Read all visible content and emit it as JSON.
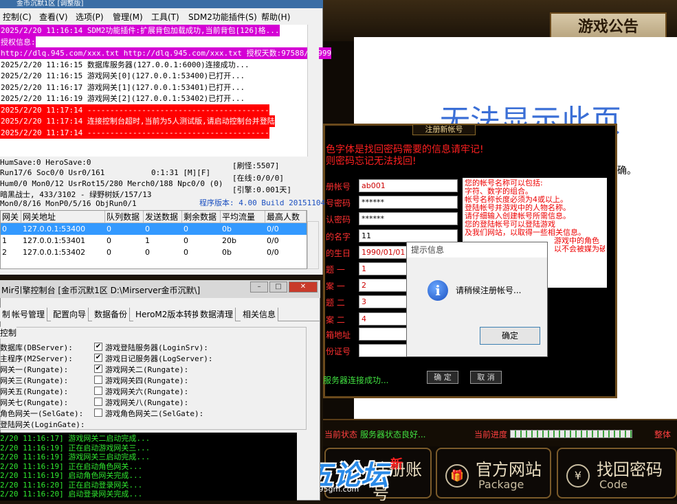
{
  "launcher": {
    "notice_title": "游戏公告",
    "notice_error": "无法显示此页",
    "notice_error_tail": "确。",
    "status_label": "当前状态",
    "status_value": "服务器状态良好...",
    "progress_label": "当前进度",
    "progress_fraction": 1.0,
    "overall_label": "整体",
    "buttons": [
      {
        "cn": "注册账号",
        "en": "",
        "icon": "user-icon"
      },
      {
        "cn": "官方网站",
        "en": "Package",
        "icon": "gift-icon"
      },
      {
        "cn": "找回密码",
        "en": "Code",
        "icon": "yen-icon"
      }
    ],
    "logo_text": "九五论坛",
    "logo_badge": "新",
    "logo_url": "www.95gm.com"
  },
  "register": {
    "title": "注册新帐号",
    "warn1": "色字体是找回密码需要的信息请牢记!",
    "warn2": "则密码忘记无法找回!",
    "fields": [
      {
        "label": "册帐号",
        "value": "ab001"
      },
      {
        "label": "号密码",
        "value": "******"
      },
      {
        "label": "认密码",
        "value": "******"
      },
      {
        "label": "的名字",
        "value": "11"
      },
      {
        "label": "的生日",
        "value": "1990/01/01"
      },
      {
        "label": "题 一",
        "value": "1"
      },
      {
        "label": "案 一",
        "value": "2"
      },
      {
        "label": "题 二",
        "value": "3"
      },
      {
        "label": "案 二",
        "value": "4"
      },
      {
        "label": "箱地址",
        "value": ""
      },
      {
        "label": "份证号",
        "value": ""
      }
    ],
    "hints": [
      "您的帐号名称可以包括:",
      "字符、数字的组合。",
      "帐号名称长度必须为4或以上。",
      "登陆帐号并游戏中的人物名称。",
      "请仔细输入创建帐号所需信息。",
      "您的登陆帐号可以登陆游戏",
      "及我们网站，以取得一些相关信息。",
      "",
      "游戏中的角色",
      "以不会被媒为破"
    ],
    "conn_text": "服务器连接成功...",
    "ok_label": "确 定",
    "cancel_label": "取 消"
  },
  "msgbox": {
    "title": "提示信息",
    "text": "请稍候注册帐号...",
    "ok_label": "确定"
  },
  "m2": {
    "title": "金币沉默1区 [调整版]",
    "menu": [
      "控制(C)",
      "查看(V)",
      "选项(P)",
      "管理(M)",
      "工具(T)",
      "SDM2功能插件(S)",
      "帮助(H)"
    ],
    "log": [
      {
        "text": "2025/2/20 11:16:14 SDM2功能插件:扩展背包加载成功,当前背包[126]格...",
        "style": "purple"
      },
      {
        "text": "授权信息:",
        "style": "purple"
      },
      {
        "text": "http://dlq.945.com/xxx.txt http://dlq.945.com/xxx.txt 授权天数:97588/99999",
        "style": "purple"
      },
      {
        "text": "2025/2/20 11:16:15 数据库服务器(127.0.0.1:6000)连接成功...",
        "style": "plain"
      },
      {
        "text": "2025/2/20 11:16:15 游戏网关[0](127.0.0.1:53400)已打开...",
        "style": "plain"
      },
      {
        "text": "2025/2/20 11:16:17 游戏网关[1](127.0.0.1:53401)已打开...",
        "style": "plain"
      },
      {
        "text": "2025/2/20 11:16:19 游戏网关[2](127.0.0.1:53402)已打开...",
        "style": "plain"
      },
      {
        "text": "2025/2/20 11:17:14 ----------------------------------------",
        "style": "red"
      },
      {
        "text": "2025/2/20 11:17:14 连接控制台超时,当前为5人测试版,请启动控制台并登陆",
        "style": "red"
      },
      {
        "text": "2025/2/20 11:17:14 ----------------------------------------",
        "style": "red"
      }
    ],
    "stats": {
      "line1": "HumSave:0 HeroSave:0",
      "line2": "Run17/6 Soc0/0 Usr0/161",
      "time": "0:1:31 [M][F]",
      "line3": "Hum0/0 Mon0/12 UsrRot15/280 Merch0/188 Npc0/0 (0)",
      "line4": "暗黑战士, 433/3102 - 绿野树妖/157/13",
      "line5": "Mon0/8/16 MonP0/5/16 ObjRun0/1",
      "refresh": "[刷怪:5507]",
      "online": "[在线:0/0/0]",
      "engine": "[引擎:0.001天]",
      "version": "程序版本: 4.00 Build 20151104"
    },
    "gateway_headers": [
      "网关",
      "网关地址",
      "队列数据",
      "发送数据",
      "剩余数据",
      "平均流量",
      "最高人数"
    ],
    "gateways": [
      [
        "0",
        "127.0.0.1:53400",
        "0",
        "0",
        "0",
        "0b",
        "0/0"
      ],
      [
        "1",
        "127.0.0.1:53401",
        "0",
        "1",
        "0",
        "20b",
        "0/0"
      ],
      [
        "2",
        "127.0.0.1:53402",
        "0",
        "0",
        "0",
        "0b",
        "0/0"
      ]
    ]
  },
  "cc": {
    "title": "Mir引擎控制台 [金币沉默1区 D:\\Mirserver金币沉默\\]",
    "tabs": [
      "制",
      "帐号管理",
      "配置向导",
      "数据备份",
      "HeroM2版本转换",
      "数据清理",
      "相关信息"
    ],
    "group_title": "控制",
    "left_items": [
      "数据库(DBServer):",
      "主程序(M2Server):",
      "网关一(Rungate):",
      "网关三(Rungate):",
      "网关五(Rungate):",
      "网关七(Rungate):",
      "角色网关一(SelGate):",
      "登陆网关(LoginGate):"
    ],
    "right_items": [
      {
        "label": "游戏登陆服务器(LoginSrv):",
        "checked": true
      },
      {
        "label": "游戏日记服务器(LogServer):",
        "checked": true
      },
      {
        "label": "游戏网关二(Rungate):",
        "checked": true
      },
      {
        "label": "游戏网关四(Rungate):",
        "checked": false
      },
      {
        "label": "游戏网关六(Rungate):",
        "checked": false
      },
      {
        "label": "游戏网关八(Rungate):",
        "checked": false
      },
      {
        "label": "游戏角色网关二(SelGate):",
        "checked": false
      }
    ],
    "console": [
      "2/20 11:16:17] 游戏网关二启动完成...",
      "2/20 11:16:19] 正在启动游戏网关三...",
      "2/20 11:16:19] 游戏网关三启动完成...",
      "2/20 11:16:19] 正在启动角色网关...",
      "2/20 11:16:19] 启动角色网关完成...",
      "2/20 11:16:20] 正在启动登录网关...",
      "2/20 11:16:20] 启动登录网关完成..."
    ]
  }
}
